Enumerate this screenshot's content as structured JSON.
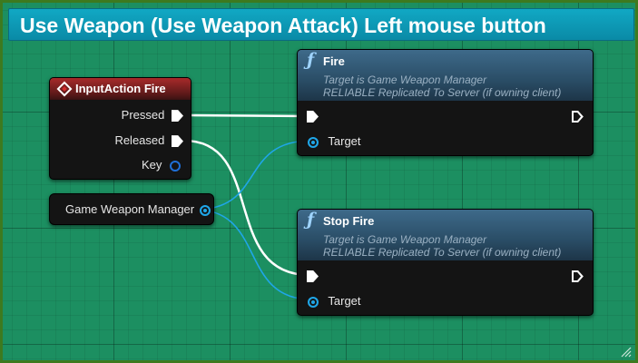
{
  "graph": {
    "title": "Use Weapon (Use Weapon Attack) Left mouse button",
    "colors": {
      "canvas": "#1c8f61",
      "border": "#3d7a1f",
      "title_bar": "#0d98b5",
      "exec_wire": "#ffffff",
      "object_wire": "#1fa6e8"
    }
  },
  "input_node": {
    "icon": "input-event-diamond-icon",
    "title": "InputAction Fire",
    "pins": {
      "pressed": "Pressed",
      "released": "Released",
      "key": "Key"
    }
  },
  "var_node": {
    "label": "Game Weapon Manager"
  },
  "fire_node": {
    "icon": "function-f-icon",
    "title": "Fire",
    "subtitle_1": "Target is Game Weapon Manager",
    "subtitle_2": "RELIABLE Replicated To Server (if owning client)",
    "target_label": "Target"
  },
  "stop_fire_node": {
    "icon": "function-f-icon",
    "title": "Stop Fire",
    "subtitle_1": "Target is Game Weapon Manager",
    "subtitle_2": "RELIABLE Replicated To Server (if owning client)",
    "target_label": "Target"
  }
}
